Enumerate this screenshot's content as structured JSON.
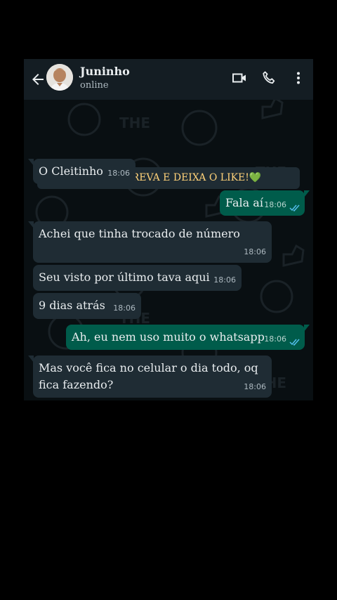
{
  "contact": {
    "name": "Juninho",
    "status": "online"
  },
  "notice": {
    "text": "SE INSCREVA E DEIXA O LIKE!💚",
    "lock_icon": "🔒"
  },
  "messages": [
    {
      "dir": "in",
      "text": "O Cleitinho",
      "time": "18:06"
    },
    {
      "dir": "out",
      "text": "Fala aí",
      "time": "18:06",
      "read": true
    },
    {
      "dir": "in",
      "text": "Achei que tinha trocado de número",
      "time": "18:06"
    },
    {
      "dir": "in",
      "text": "Seu visto por último tava aqui",
      "time": "18:06"
    },
    {
      "dir": "in",
      "text": "9 dias atrás",
      "time": "18:06"
    },
    {
      "dir": "out",
      "text": "Ah, eu nem uso muito o whatsapp",
      "time": "18:06",
      "read": true
    },
    {
      "dir": "in",
      "text_lines": [
        "Mas você fica no celular o dia todo, oq",
        "fica fazendo?"
      ],
      "time": "18:06"
    }
  ],
  "icons": {
    "back": "arrow-left-icon",
    "video": "video-call-icon",
    "call": "phone-icon",
    "menu": "more-vertical-icon"
  },
  "colors": {
    "incoming": "#1f2c34",
    "outgoing": "#005c4b",
    "read_ticks": "#53bdeb",
    "notice_text": "#ffd279"
  }
}
